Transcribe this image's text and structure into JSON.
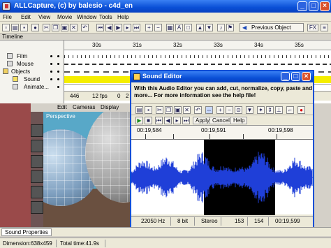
{
  "window": {
    "title": "ALLCapture, (c) by balesio - c4d_en"
  },
  "menubar": {
    "items": [
      "File",
      "Edit",
      "View",
      "Movie",
      "Window",
      "Tools",
      "Help"
    ]
  },
  "toolbar": {
    "previous_object_label": "Previous Object",
    "fx_label": "FX"
  },
  "timeline": {
    "header": "Timeline",
    "tracks": [
      "Film",
      "Mouse",
      "Objects",
      "Sound",
      "Animate..."
    ],
    "ruler_labels": [
      "30s",
      "31s",
      "32s",
      "33s",
      "34s",
      "35s"
    ],
    "status": {
      "frame": "446",
      "fps": "12 fps",
      "value": "0",
      "count": "2"
    }
  },
  "viewport": {
    "menu": [
      "Edit",
      "Cameras",
      "Display"
    ],
    "label": "Perspective"
  },
  "sound_editor": {
    "title": "Sound Editor",
    "info": "With this Audio Editor you can add, cut, normalize, copy, paste and more... For more information see the help file!",
    "buttons": {
      "apply": "Apply",
      "cancel": "Cancel",
      "help": "Help"
    },
    "time_labels": [
      "00:19,584",
      "00:19,591",
      "00:19,598"
    ],
    "status": {
      "sample_rate": "22050 Hz",
      "bits": "8 bit",
      "channels": "Stereo",
      "value1": "153",
      "value2": "154",
      "position": "00:19,599"
    }
  },
  "panels": {
    "sound_properties": "Sound Properties"
  },
  "statusbar": {
    "dimension": "Dimension:638x459",
    "total_time": "Total time:41.9s"
  }
}
